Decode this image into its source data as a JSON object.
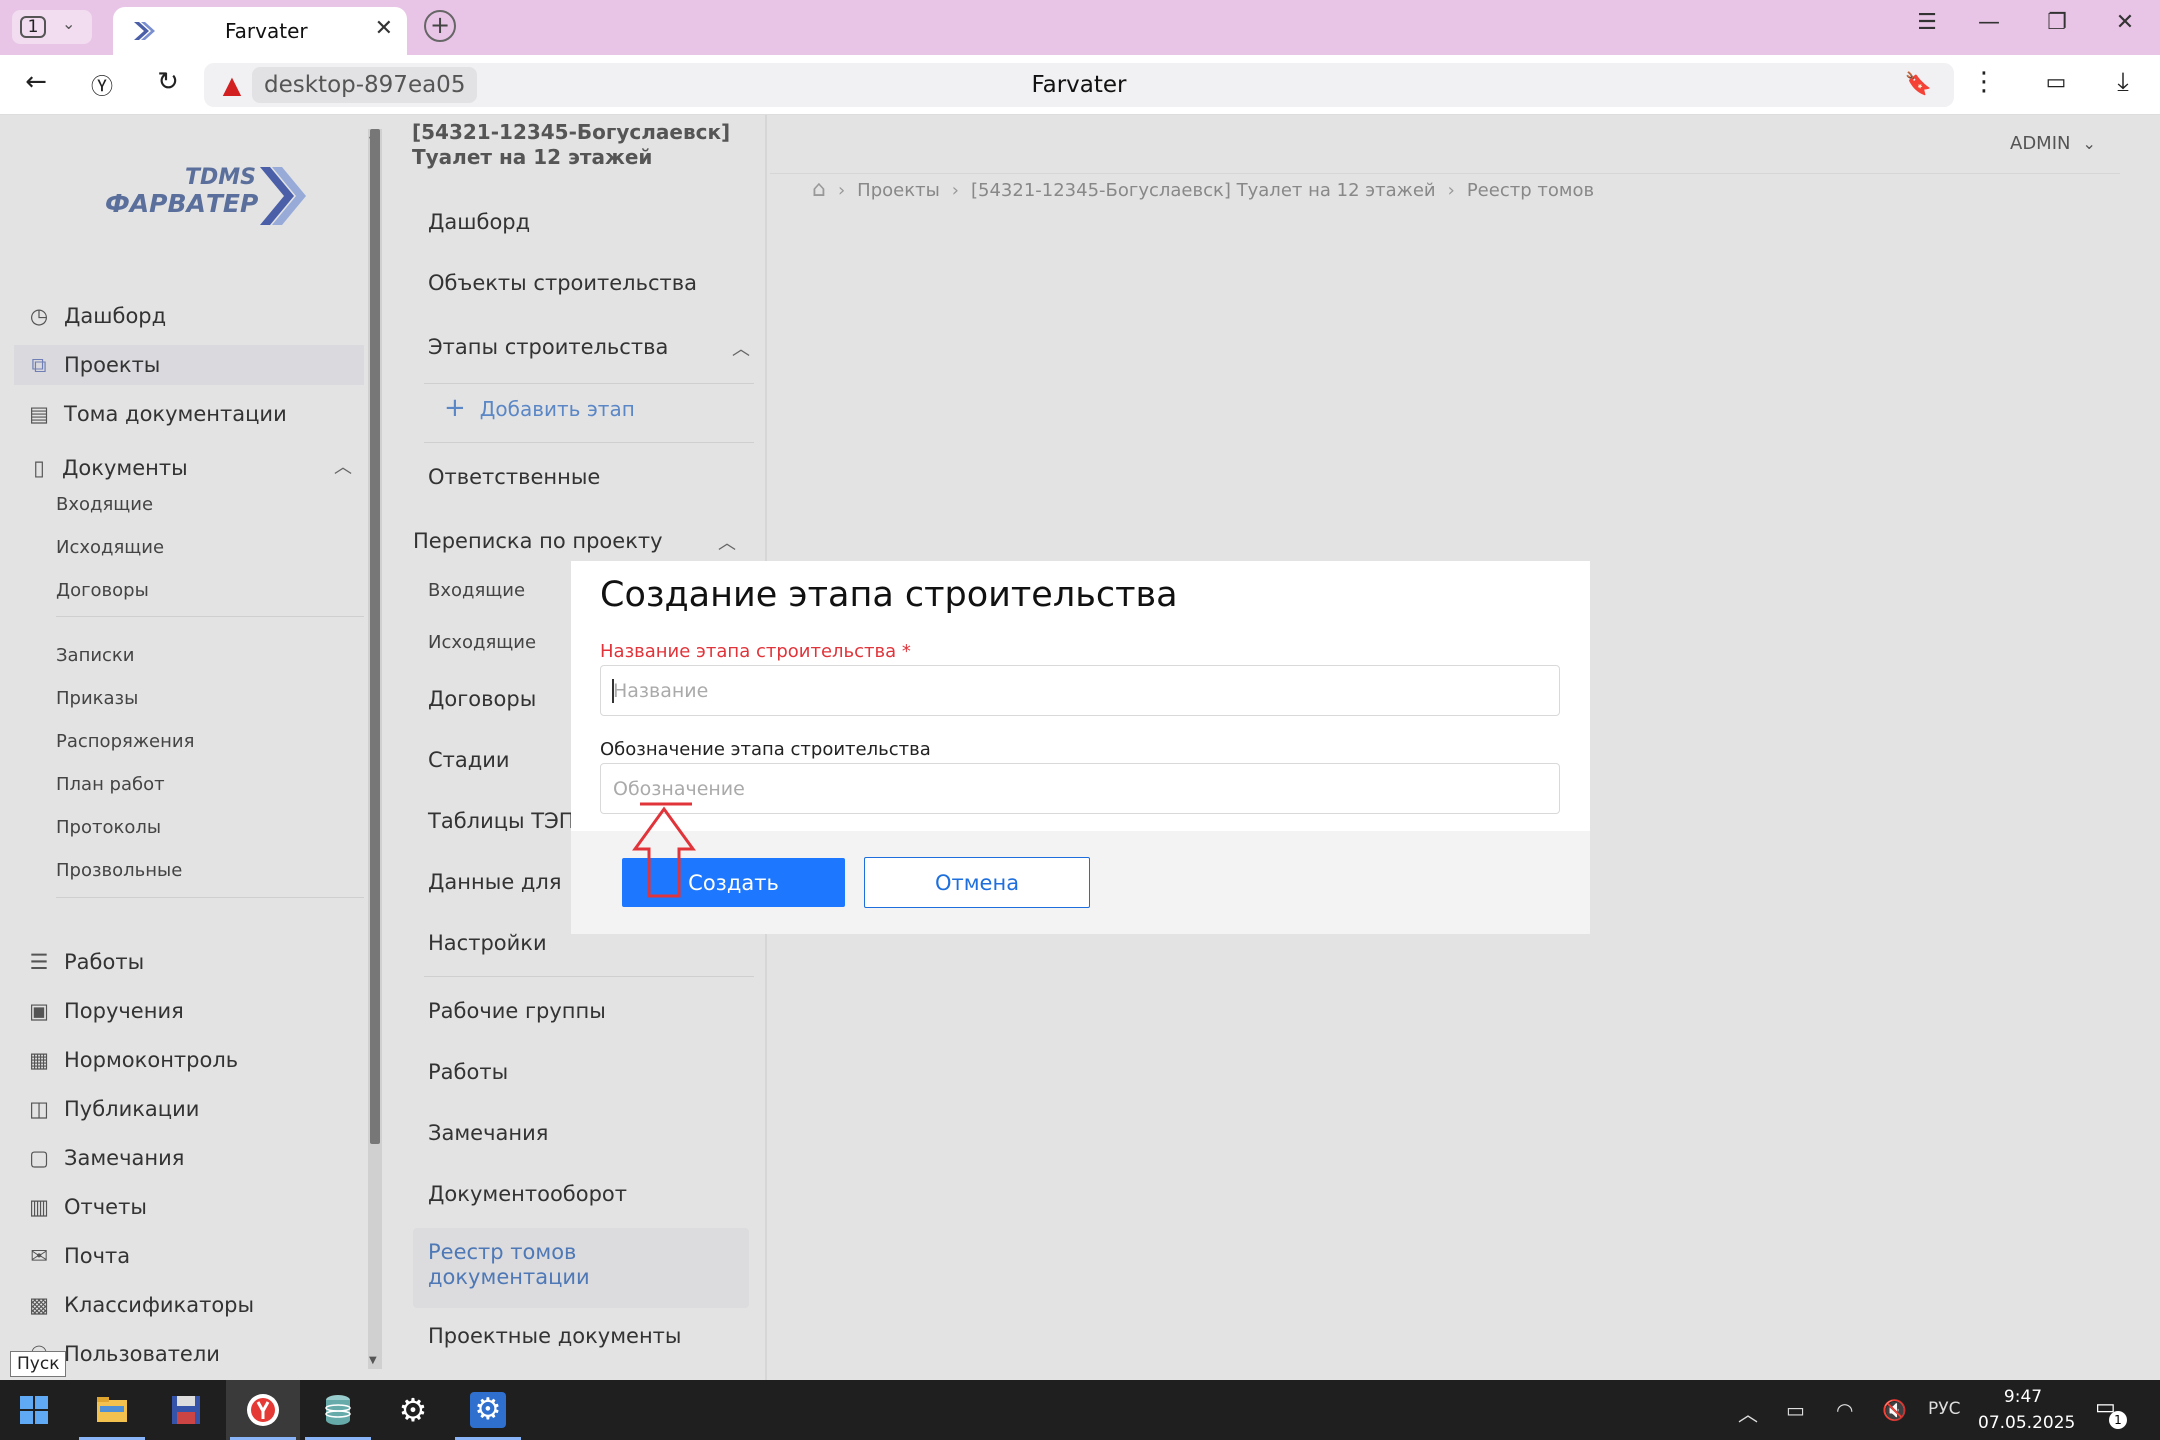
{
  "browser": {
    "tab_count": "1",
    "tab_title": "Farvater",
    "url_host": "desktop-897ea05",
    "page_title": "Farvater"
  },
  "logo": {
    "line1": "TDMS",
    "line2": "ФАРВАТЕР"
  },
  "sidebar": {
    "items": [
      {
        "label": "Дашборд",
        "icon": "clock-icon"
      },
      {
        "label": "Проекты",
        "icon": "projects-icon",
        "active": true
      },
      {
        "label": "Тома документации",
        "icon": "archive-icon"
      },
      {
        "label": "Документы",
        "icon": "document-icon",
        "expanded": true
      }
    ],
    "documents_sub": [
      "Входящие",
      "Исходящие",
      "Договоры"
    ],
    "documents_sub2": [
      "Записки",
      "Приказы",
      "Распоряжения",
      "План работ",
      "Протоколы",
      "Прозвольные"
    ],
    "items2": [
      {
        "label": "Работы",
        "icon": "tasks-icon"
      },
      {
        "label": "Поручения",
        "icon": "clipboard-icon"
      },
      {
        "label": "Нормоконтроль",
        "icon": "checklist-icon"
      },
      {
        "label": "Публикации",
        "icon": "book-icon"
      },
      {
        "label": "Замечания",
        "icon": "comment-icon"
      },
      {
        "label": "Отчеты",
        "icon": "report-icon"
      },
      {
        "label": "Почта",
        "icon": "mail-icon"
      },
      {
        "label": "Классификаторы",
        "icon": "grid-icon"
      },
      {
        "label": "Пользователи",
        "icon": "users-icon"
      }
    ]
  },
  "project_menu": {
    "title": "[54321-12345-Богуслаевск] Туалет на 12 этажей",
    "items": [
      "Дашборд",
      "Объекты строительства",
      "Этапы строительства"
    ],
    "add_stage": "Добавить этап",
    "responsible": "Ответственные",
    "correspondence": "Переписка по проекту",
    "corr_sub": [
      "Входящие",
      "Исходящие"
    ],
    "items2": [
      "Договоры",
      "Стадии",
      "Таблицы ТЭП",
      "Данные для",
      "Настройки"
    ],
    "items3": [
      "Рабочие группы",
      "Работы",
      "Замечания",
      "Документооборот"
    ],
    "highlighted": "Реестр томов документации",
    "last": "Проектные документы"
  },
  "header": {
    "user": "ADMIN",
    "breadcrumbs": [
      "Проекты",
      "[54321-12345-Богуслаевск] Туалет на 12 этажей",
      "Реестр томов"
    ]
  },
  "modal": {
    "title": "Создание этапа строительства",
    "name_label": "Название этапа строительства *",
    "name_placeholder": "Название",
    "code_label": "Обозначение этапа строительства",
    "code_placeholder": "Обозначение",
    "create_btn": "Создать",
    "cancel_btn": "Отмена"
  },
  "tooltip": "Пуск",
  "taskbar": {
    "lang": "РУС",
    "time": "9:47",
    "date": "07.05.2025",
    "notifications": "1"
  },
  "colors": {
    "primary": "#1e78ff",
    "required": "#e0343a",
    "link": "#5b87c6",
    "tab_bar": "#e8c4e6"
  }
}
